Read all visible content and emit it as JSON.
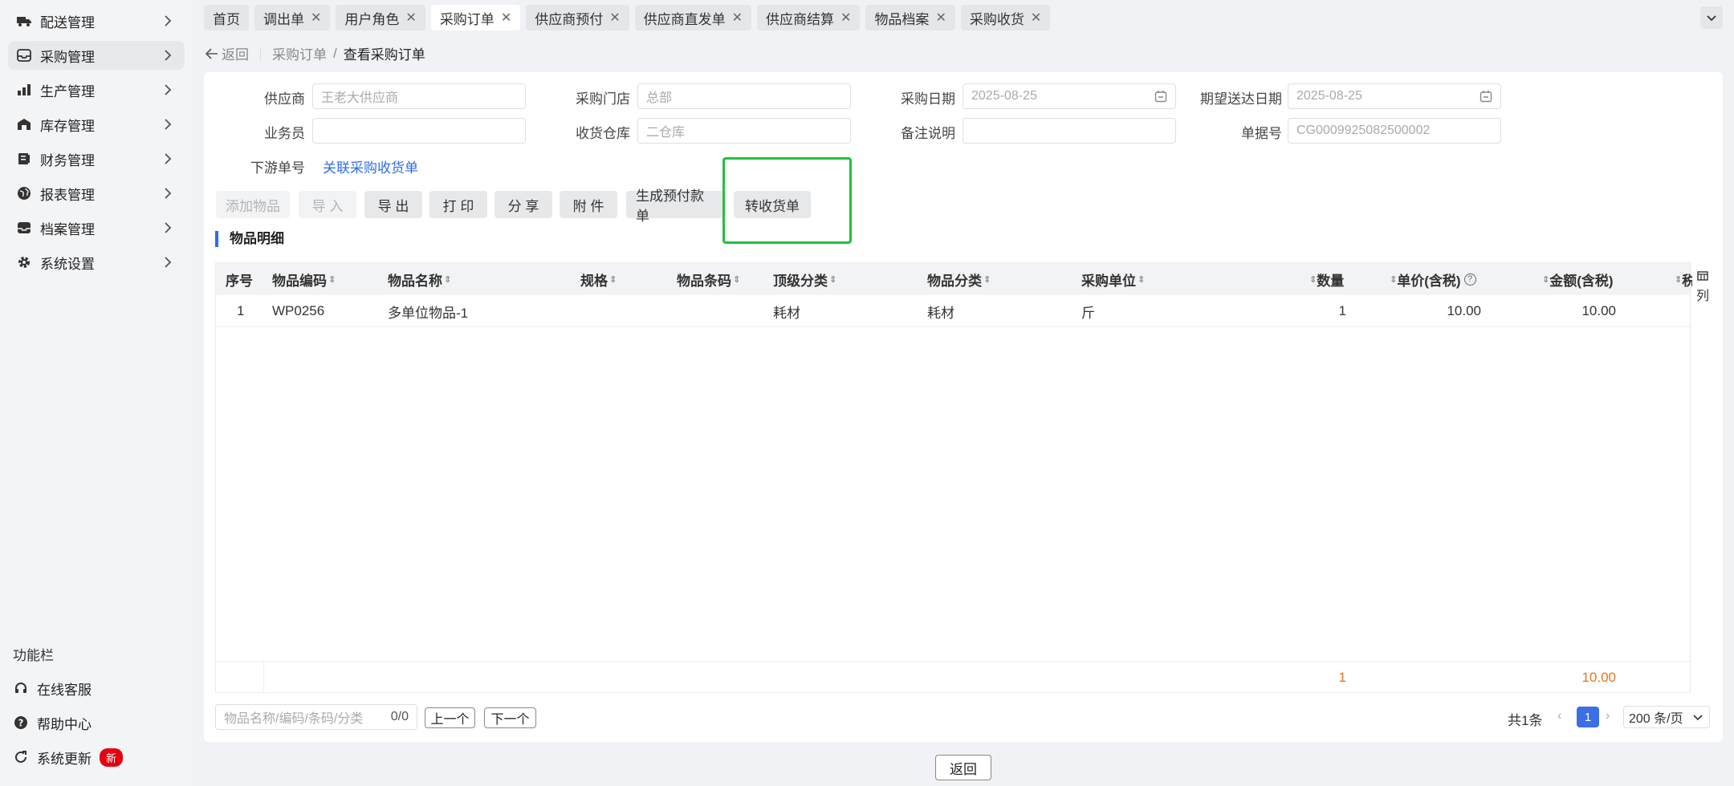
{
  "sidebar": {
    "items": [
      {
        "label": "配送管理",
        "icon": "truck-icon"
      },
      {
        "label": "采购管理",
        "icon": "inbox-icon"
      },
      {
        "label": "生产管理",
        "icon": "factory-icon"
      },
      {
        "label": "库存管理",
        "icon": "warehouse-icon"
      },
      {
        "label": "财务管理",
        "icon": "ledger-icon"
      },
      {
        "label": "报表管理",
        "icon": "globe-icon"
      },
      {
        "label": "档案管理",
        "icon": "archive-icon"
      },
      {
        "label": "系统设置",
        "icon": "gear-icon"
      }
    ],
    "function_title": "功能栏",
    "footer": [
      {
        "label": "在线客服",
        "icon": "headset-icon"
      },
      {
        "label": "帮助中心",
        "icon": "help-icon"
      },
      {
        "label": "系统更新",
        "icon": "refresh-icon",
        "badge": "新"
      }
    ]
  },
  "tabs": [
    {
      "label": "首页",
      "closable": false
    },
    {
      "label": "调出单",
      "closable": true
    },
    {
      "label": "用户角色",
      "closable": true
    },
    {
      "label": "采购订单",
      "closable": true,
      "active": true
    },
    {
      "label": "供应商预付",
      "closable": true
    },
    {
      "label": "供应商直发单",
      "closable": true
    },
    {
      "label": "供应商结算",
      "closable": true
    },
    {
      "label": "物品档案",
      "closable": true
    },
    {
      "label": "采购收货",
      "closable": true
    }
  ],
  "breadcrumb": {
    "back": "返回",
    "parent": "采购订单",
    "current": "查看采购订单"
  },
  "form": {
    "supplier_label": "供应商",
    "supplier_value": "王老大供应商",
    "store_label": "采购门店",
    "store_value": "总部",
    "purchase_date_label": "采购日期",
    "purchase_date_value": "2025-08-25",
    "expected_date_label": "期望送达日期",
    "expected_date_value": "2025-08-25",
    "salesman_label": "业务员",
    "salesman_value": "",
    "warehouse_label": "收货仓库",
    "warehouse_value": "二仓库",
    "remark_label": "备注说明",
    "remark_value": "",
    "doc_no_label": "单据号",
    "doc_no_value": "CG0009925082500002",
    "downstream_label": "下游单号",
    "downstream_link": "关联采购收货单"
  },
  "toolbar": {
    "add_item": "添加物品",
    "import": "导 入",
    "export": "导 出",
    "print": "打 印",
    "share": "分 享",
    "attachment": "附 件",
    "gen_prepay": "生成预付款单",
    "to_receipt": "转收货单"
  },
  "section_title": "物品明细",
  "table": {
    "headers": {
      "idx": "序号",
      "code": "物品编码",
      "name": "物品名称",
      "spec": "规格",
      "barcode": "物品条码",
      "top_cat": "顶级分类",
      "cat": "物品分类",
      "unit": "采购单位",
      "qty": "数量",
      "price": "单价(含税)",
      "amount": "金额(含税)",
      "more": "税"
    },
    "rows": [
      {
        "idx": "1",
        "code": "WP0256",
        "name": "多单位物品-1",
        "spec": "",
        "barcode": "",
        "top_cat": "耗材",
        "cat": "耗材",
        "unit": "斤",
        "qty": "1",
        "price": "10.00",
        "amount": "10.00"
      }
    ],
    "summary": {
      "qty": "1",
      "amount": "10.00"
    },
    "col_toggle": "列"
  },
  "footer": {
    "search_placeholder": "物品名称/编码/条码/分类",
    "search_count": "0/0",
    "prev": "上一个",
    "next": "下一个",
    "total": "共1条",
    "page": "1",
    "page_size": "200 条/页"
  },
  "bottom_back": "返回",
  "colors": {
    "accent": "#2f6de6",
    "highlight": "#22c040",
    "sum": "#e8741c",
    "badge": "#e60012"
  }
}
